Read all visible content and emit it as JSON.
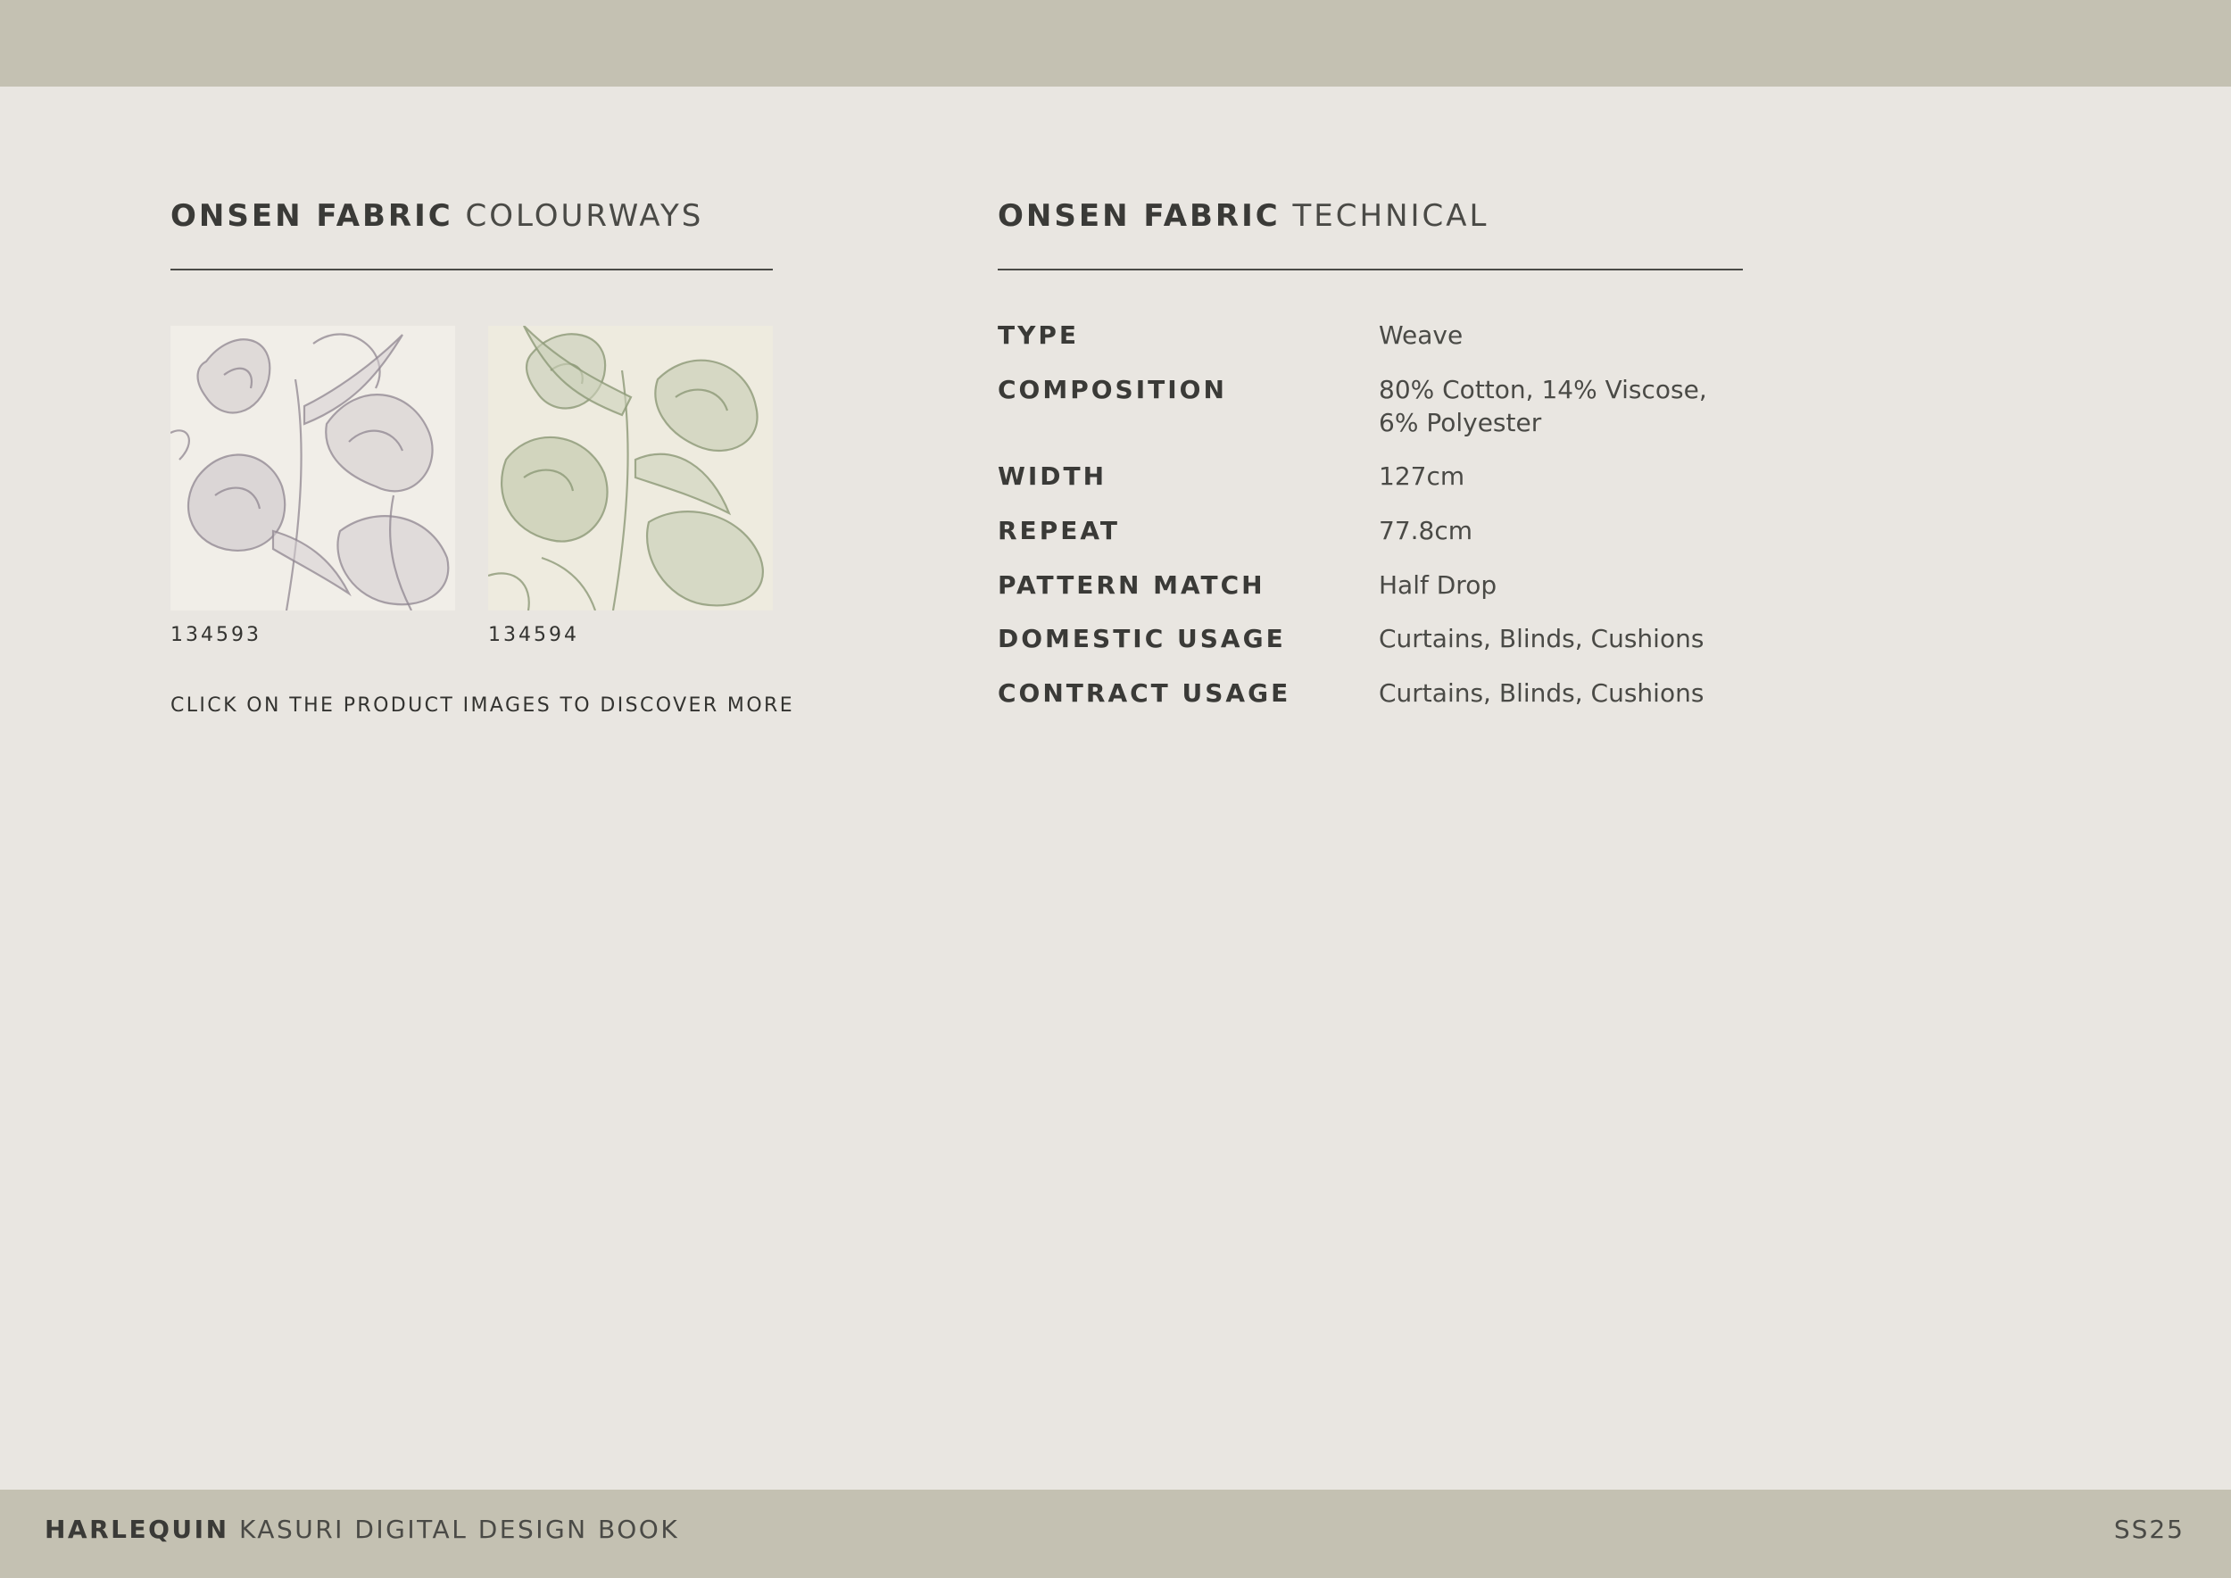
{
  "colourways": {
    "title_strong": "ONSEN FABRIC",
    "title_light": "COLOURWAYS",
    "swatches": [
      {
        "code": "134593",
        "colour": "#8f8590",
        "ground": "#f1eee8"
      },
      {
        "code": "134594",
        "colour": "#8c9877",
        "ground": "#eeebdf"
      }
    ],
    "cta": "CLICK ON THE PRODUCT IMAGES TO DISCOVER MORE"
  },
  "technical": {
    "title_strong": "ONSEN FABRIC",
    "title_light": "TECHNICAL",
    "specs": [
      {
        "label": "TYPE",
        "value": "Weave"
      },
      {
        "label": "COMPOSITION",
        "value": "80% Cotton, 14% Viscose,",
        "value_line2": "6% Polyester"
      },
      {
        "label": "WIDTH",
        "value": "127cm"
      },
      {
        "label": "REPEAT",
        "value": "77.8cm"
      },
      {
        "label": "PATTERN MATCH",
        "value": "Half Drop"
      },
      {
        "label": "DOMESTIC USAGE",
        "value": "Curtains, Blinds, Cushions"
      },
      {
        "label": "CONTRACT USAGE",
        "value": "Curtains, Blinds, Cushions"
      }
    ]
  },
  "footer": {
    "brand": "HARLEQUIN",
    "book_title": "KASURI DIGITAL DESIGN BOOK",
    "season": "SS25"
  },
  "colors": {
    "band": "#c4c1b2",
    "page": "#e9e6e1"
  }
}
